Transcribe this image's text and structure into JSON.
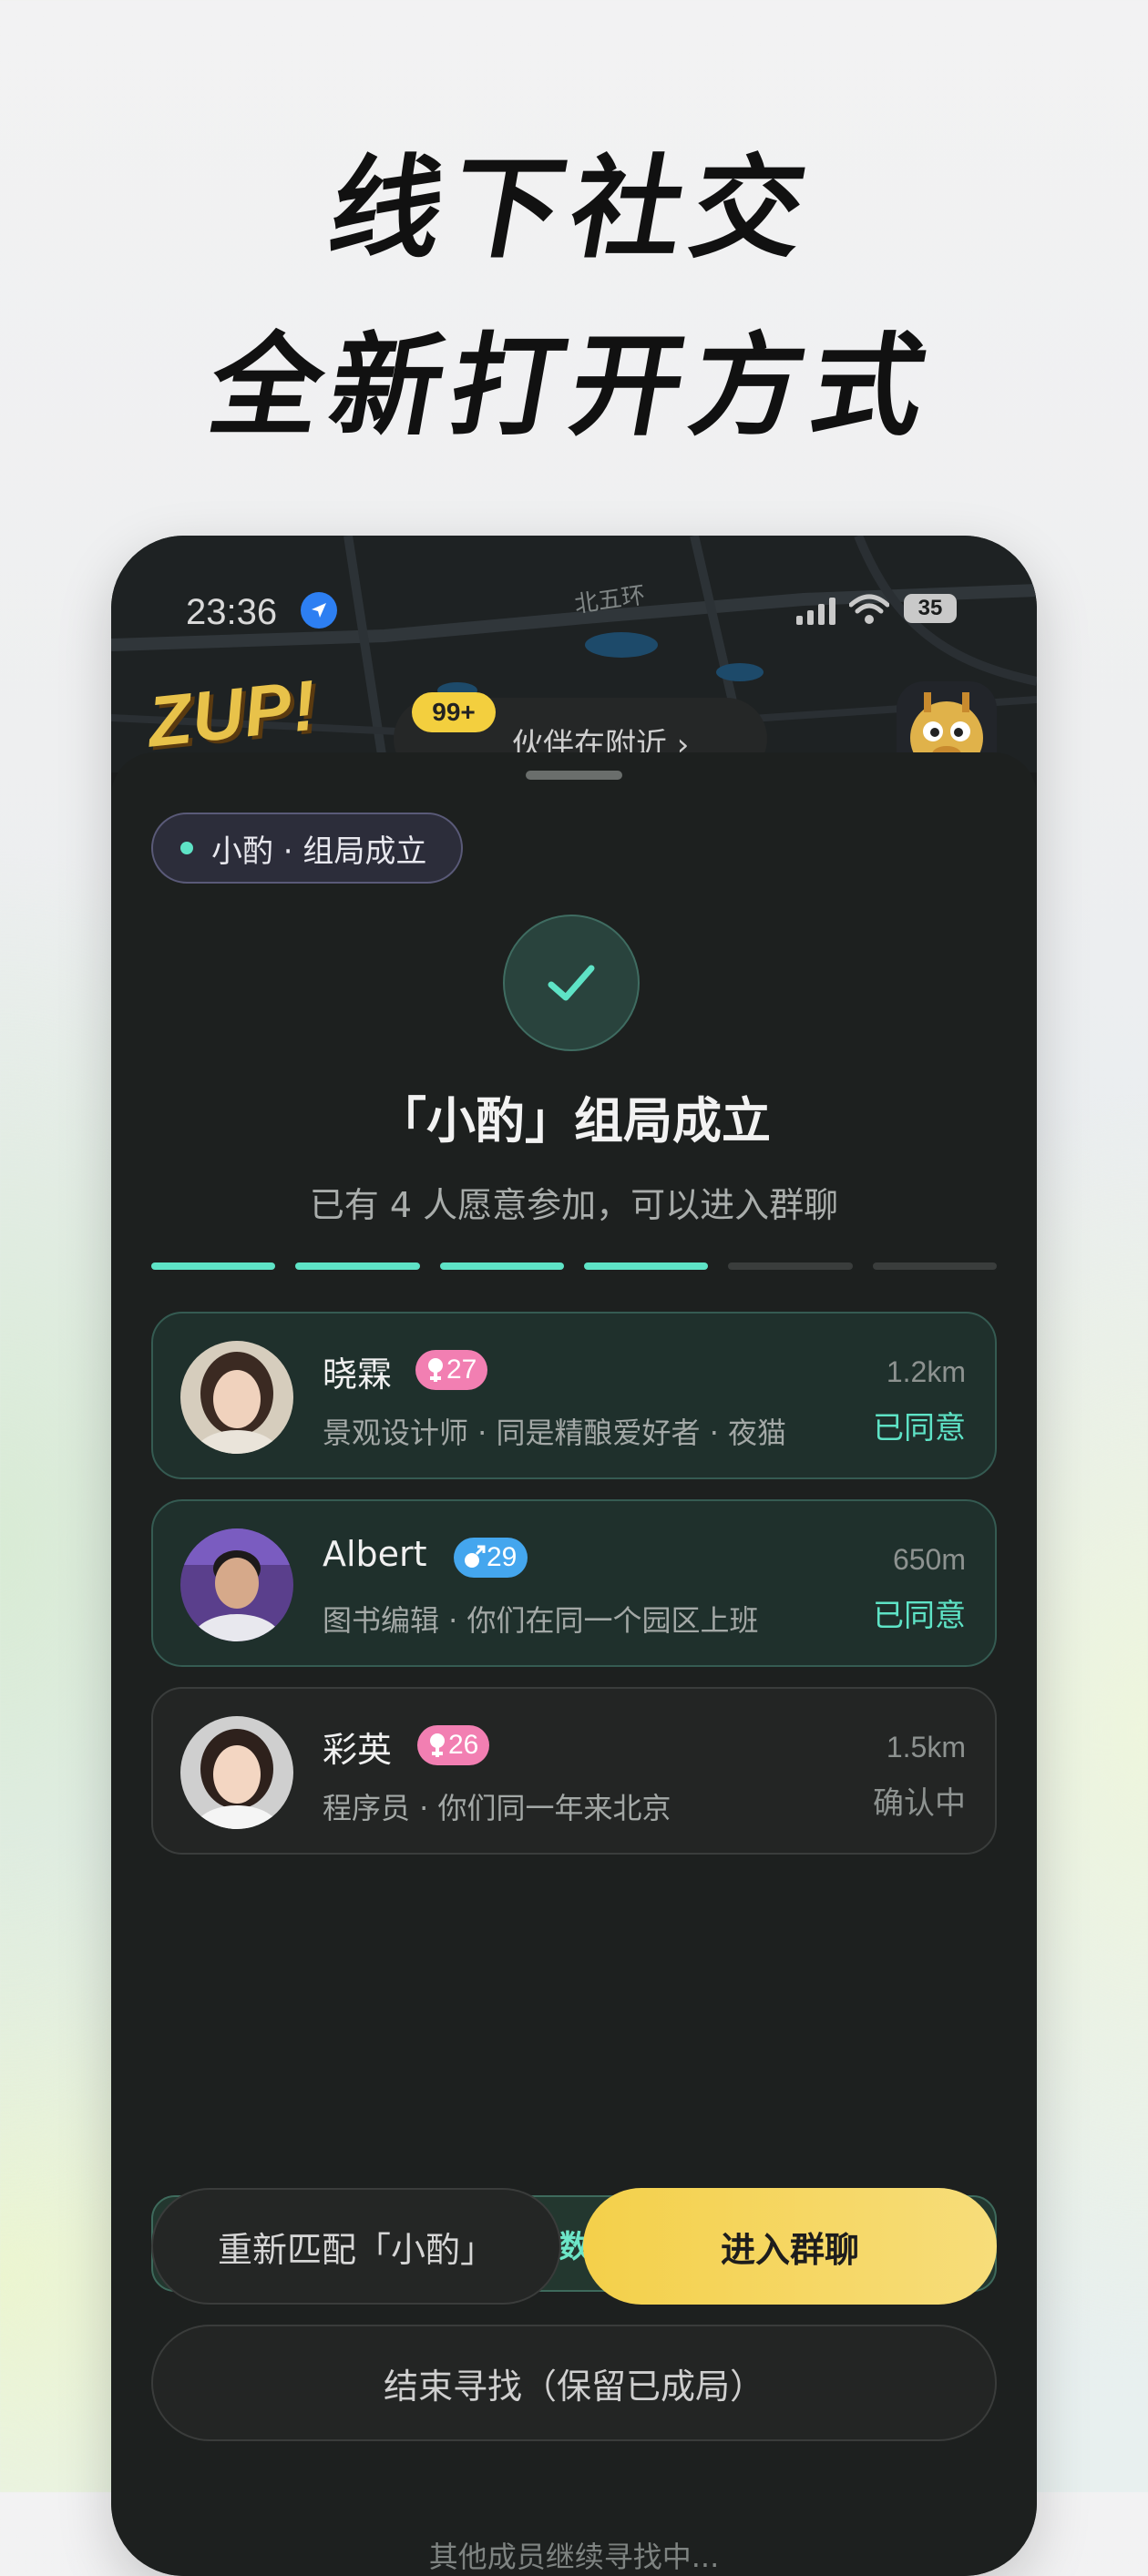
{
  "headline": {
    "line1": "线下社交",
    "line2": "全新打开方式"
  },
  "status_bar": {
    "time": "23:36",
    "battery": "35"
  },
  "map": {
    "road_label": "北五环",
    "logo_text": "ZUP!",
    "nearby_badge": "99+",
    "nearby_text": "伙伴在附近 ›"
  },
  "sheet": {
    "chip_label": "小酌 · 组局成立",
    "title": "「小酌」组局成立",
    "subtitle": "已有 4 人愿意参加，可以进入群聊",
    "progress": {
      "filled": 4,
      "total": 6,
      "colors": {
        "filled": "#5ee3c6",
        "empty": "#3a3d3c"
      }
    },
    "members": [
      {
        "name": "晓霖",
        "gender": "female",
        "age": "27",
        "desc": "景观设计师 · 同是精酿爱好者 · 夜猫",
        "distance": "1.2km",
        "status": "已同意"
      },
      {
        "name": "Albert",
        "gender": "male",
        "age": "29",
        "desc": "图书编辑 · 你们在同一个园区上班",
        "distance": "650m",
        "status": "已同意"
      },
      {
        "name": "彩英",
        "gender": "female",
        "age": "26",
        "desc": "程序员 · 你们同一年来北京",
        "distance": "1.5km",
        "status": "确认中"
      }
    ],
    "notice": "已达到成局人数，群聊已创建",
    "searching": "其他成员继续寻找中...",
    "buttons": {
      "rematch": "重新匹配「小酌」",
      "enter": "进入群聊",
      "end": "结束寻找（保留已成局）"
    }
  },
  "colors": {
    "accent": "#5ee3c6",
    "yellow": "#f4d04a",
    "female": "#f27fb2",
    "male": "#44a6ee"
  }
}
